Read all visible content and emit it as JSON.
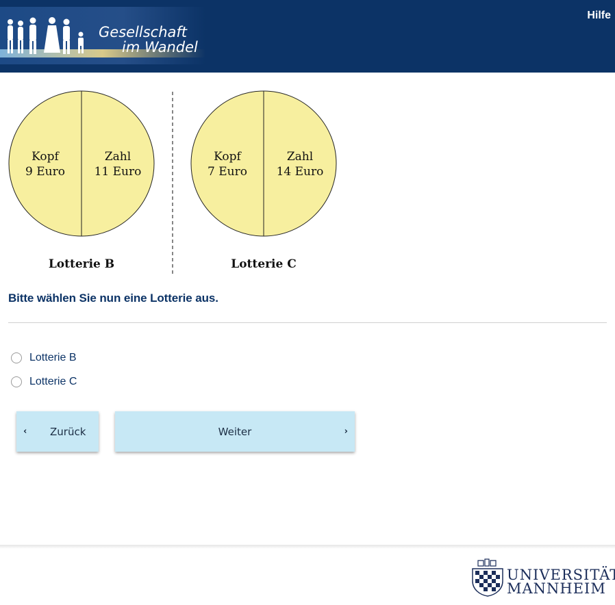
{
  "header": {
    "logo_line1": "Gesellschaft",
    "logo_line2": "im Wandel",
    "help_label": "Hilfe",
    "background_color": "#0c3366"
  },
  "lotteries": [
    {
      "title": "Lotterie B",
      "left_label": "Kopf",
      "left_value": "9 Euro",
      "right_label": "Zahl",
      "right_value": "11 Euro"
    },
    {
      "title": "Lotterie C",
      "left_label": "Kopf",
      "left_value": "7 Euro",
      "right_label": "Zahl",
      "right_value": "14 Euro"
    }
  ],
  "question": "Bitte wählen Sie nun eine Lotterie aus.",
  "options": [
    {
      "label": "Lotterie B",
      "selected": false
    },
    {
      "label": "Lotterie C",
      "selected": false
    }
  ],
  "navigation": {
    "back_label": "Zurück",
    "next_label": "Weiter",
    "back_icon": "chevron-left-icon",
    "next_icon": "chevron-right-icon",
    "button_color": "#c7e8f5"
  },
  "footer": {
    "uni_line1": "UNIVERSITÄT",
    "uni_line2": "MANNHEIM"
  }
}
